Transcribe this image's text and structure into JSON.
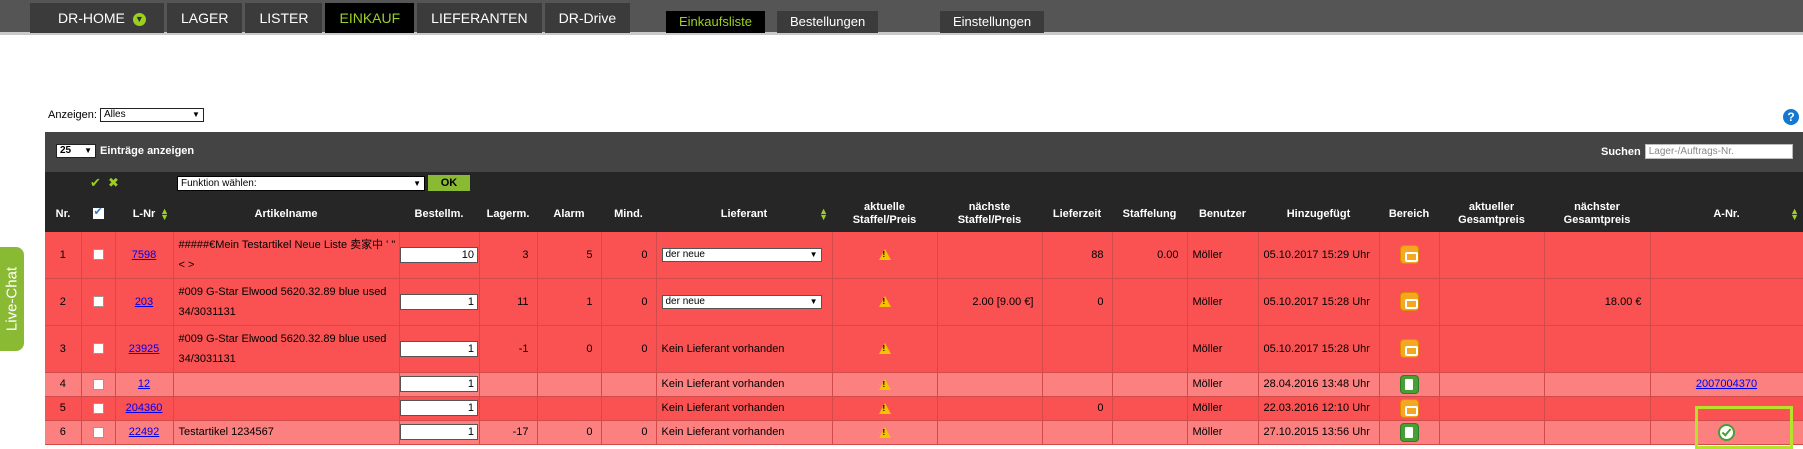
{
  "nav": {
    "tabs": [
      {
        "label": "DR-HOME"
      },
      {
        "label": "LAGER"
      },
      {
        "label": "LISTER"
      },
      {
        "label": "EINKAUF"
      },
      {
        "label": "LIEFERANTEN"
      },
      {
        "label": "DR-Drive"
      }
    ],
    "active_tab": "EINKAUF",
    "subtabs": [
      {
        "label": "Einkaufsliste"
      },
      {
        "label": "Bestellungen"
      },
      {
        "label": "Einstellungen"
      }
    ],
    "active_subtab": "Einkaufsliste"
  },
  "livechat": {
    "label": "Live-Chat"
  },
  "filter": {
    "label": "Anzeigen:",
    "value": "Alles"
  },
  "help": {
    "glyph": "?"
  },
  "toolbar": {
    "entries_value": "25",
    "entries_label": "Einträge anzeigen",
    "search_label": "Suchen",
    "search_placeholder": "Lager-/Auftrags-Nr."
  },
  "actions": {
    "check_all": "✔",
    "uncheck_all": "✖",
    "function_select": "Funktion wählen:",
    "ok_label": "OK"
  },
  "columns": [
    {
      "label": "Nr."
    },
    {
      "label": ""
    },
    {
      "label": "L-Nr",
      "sortable": true
    },
    {
      "label": "Artikelname"
    },
    {
      "label": "Bestellm."
    },
    {
      "label": "Lagerm."
    },
    {
      "label": "Alarm"
    },
    {
      "label": "Mind."
    },
    {
      "label": "Lieferant",
      "sortable": true
    },
    {
      "label": "aktuelle Staffel/Preis"
    },
    {
      "label": "nächste Staffel/Preis"
    },
    {
      "label": "Lieferzeit"
    },
    {
      "label": "Staffelung"
    },
    {
      "label": "Benutzer"
    },
    {
      "label": "Hinzugefügt"
    },
    {
      "label": "Bereich"
    },
    {
      "label": "aktueller Gesamtpreis"
    },
    {
      "label": "nächster Gesamtpreis"
    },
    {
      "label": "A-Nr.",
      "sortable": true
    }
  ],
  "rows": [
    {
      "nr": "1",
      "lnr": "7598",
      "name": "#####€Mein Testartikel Neue Liste 卖家中 ' \" < >",
      "qty": "10",
      "lager": "3",
      "alarm": "5",
      "mind": "0",
      "supplier": "der neue",
      "supplier_select": true,
      "next": "",
      "lieferzeit": "88",
      "staffelung": "0.00",
      "user": "Möller",
      "added": "05.10.2017 15:29 Uhr",
      "bereich": "orange",
      "akt_total": "",
      "next_total": "",
      "anr": "",
      "style": "r1"
    },
    {
      "nr": "2",
      "lnr": "203",
      "name": "#009 G-Star Elwood 5620.32.89 blue used 34/3031131",
      "qty": "1",
      "lager": "11",
      "alarm": "1",
      "mind": "0",
      "supplier": "der neue",
      "supplier_select": true,
      "next": "2.00 [9.00 €]",
      "lieferzeit": "0",
      "staffelung": "",
      "user": "Möller",
      "added": "05.10.2017 15:28 Uhr",
      "bereich": "orange",
      "akt_total": "",
      "next_total": "18.00 €",
      "anr": "",
      "style": "r1"
    },
    {
      "nr": "3",
      "lnr": "23925",
      "name": "#009 G-Star Elwood 5620.32.89 blue used 34/3031131",
      "qty": "1",
      "lager": "-1",
      "alarm": "0",
      "mind": "0",
      "supplier": "Kein Lieferant vorhanden",
      "supplier_select": false,
      "next": "",
      "lieferzeit": "",
      "staffelung": "",
      "user": "Möller",
      "added": "05.10.2017 15:28 Uhr",
      "bereich": "orange",
      "akt_total": "",
      "next_total": "",
      "anr": "",
      "style": "r1"
    },
    {
      "nr": "4",
      "lnr": "12",
      "name": "",
      "qty": "1",
      "lager": "",
      "alarm": "",
      "mind": "",
      "supplier": "Kein Lieferant vorhanden",
      "supplier_select": false,
      "next": "",
      "lieferzeit": "",
      "staffelung": "",
      "user": "Möller",
      "added": "28.04.2016 13:48 Uhr",
      "bereich": "green",
      "akt_total": "",
      "next_total": "",
      "anr": "2007004370",
      "style": "r2"
    },
    {
      "nr": "5",
      "lnr": "204360",
      "name": "",
      "qty": "1",
      "lager": "",
      "alarm": "",
      "mind": "",
      "supplier": "Kein Lieferant vorhanden",
      "supplier_select": false,
      "next": "",
      "lieferzeit": "0",
      "staffelung": "",
      "user": "Möller",
      "added": "22.03.2016 12:10 Uhr",
      "bereich": "orange",
      "akt_total": "",
      "next_total": "",
      "anr": "",
      "style": "r1"
    },
    {
      "nr": "6",
      "lnr": "22492",
      "name": "Testartikel 1234567",
      "qty": "1",
      "lager": "-17",
      "alarm": "0",
      "mind": "0",
      "supplier": "Kein Lieferant vorhanden",
      "supplier_select": false,
      "next": "",
      "lieferzeit": "",
      "staffelung": "",
      "user": "Möller",
      "added": "27.10.2015 13:56 Uhr",
      "bereich": "green",
      "akt_total": "",
      "next_total": "",
      "anr": "",
      "anr_icon": "check-circle-icon",
      "style": "r2"
    }
  ],
  "colors": {
    "accent": "#9bd022",
    "row_red": "#fa5252",
    "row_light": "#fc8080",
    "header": "#262626"
  }
}
